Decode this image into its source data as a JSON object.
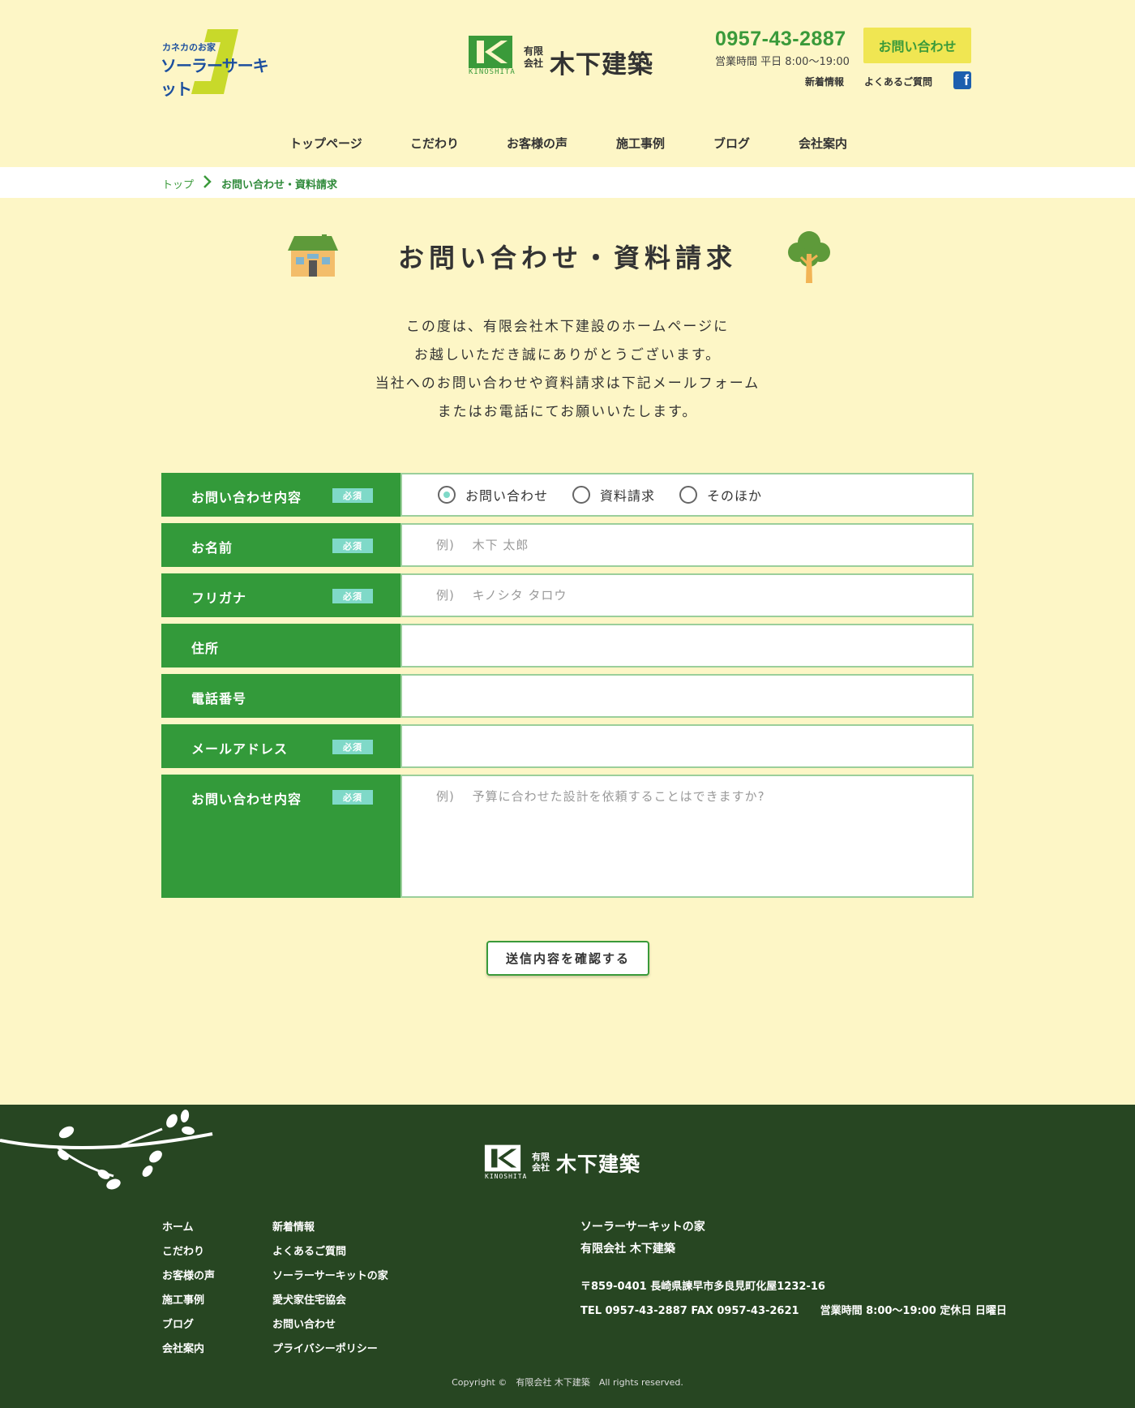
{
  "header": {
    "solar_logo_small": "カネカのお家",
    "solar_logo_main": "ソーラーサーキット",
    "brand_small_1": "有限",
    "brand_small_2": "会社",
    "brand_main": "木下建築",
    "brand_kino": "KINOSHITA",
    "phone": "0957-43-2887",
    "hours": "営業時間 平日 8:00〜19:00",
    "contact_button": "お問い合わせ",
    "util_news": "新着情報",
    "util_faq": "よくあるご質問",
    "facebook_glyph": "f"
  },
  "nav": [
    "トップページ",
    "こだわり",
    "お客様の声",
    "施工事例",
    "ブログ",
    "会社案内"
  ],
  "breadcrumb": {
    "top": "トップ",
    "current": "お問い合わせ・資料請求"
  },
  "main": {
    "title": "お問い合わせ・資料請求",
    "intro": [
      "この度は、有限会社木下建設のホームページに",
      "お越しいただき誠にありがとうございます。",
      "当社へのお問い合わせや資料請求は下記メールフォーム",
      "またはお電話にてお願いいたします。"
    ]
  },
  "form": {
    "required_badge": "必須",
    "type_label": "お問い合わせ内容",
    "type_options": [
      "お問い合わせ",
      "資料請求",
      "そのほか"
    ],
    "type_selected": "お問い合わせ",
    "name_label": "お名前",
    "name_placeholder": "例)　 木下 太郎",
    "kana_label": "フリガナ",
    "kana_placeholder": "例)　 キノシタ タロウ",
    "address_label": "住所",
    "address_value": "",
    "phone_label": "電話番号",
    "phone_value": "",
    "email_label": "メールアドレス",
    "email_value": "",
    "message_label": "お問い合わせ内容",
    "message_placeholder": "例)　 予算に合わせた設計を依頼することはできますか?",
    "submit_label": "送信内容を確認する"
  },
  "footer": {
    "brand_small_1": "有限",
    "brand_small_2": "会社",
    "brand_main": "木下建築",
    "brand_kino": "KINOSHITA",
    "links_col1": [
      "ホーム",
      "こだわり",
      "お客様の声",
      "施工事例",
      "ブログ",
      "会社案内"
    ],
    "links_col2": [
      "新着情報",
      "よくあるご質問",
      "ソーラーサーキットの家",
      "愛犬家住宅協会",
      "お問い合わせ",
      "プライバシーポリシー"
    ],
    "company_line1": "ソーラーサーキットの家",
    "company_line2": "有限会社 木下建築",
    "address": "〒859-0401 長崎県諫早市多良見町化屋1232-16",
    "tel_line": "TEL 0957-43-2887 FAX 0957-43-2621　　営業時間 8:00〜19:00 定休日 日曜日",
    "copyright": "Copyright ©　有限会社 木下建築　All rights reserved."
  },
  "colors": {
    "background": "#fdf6c6",
    "accent_green": "#339a3a",
    "footer_green": "#274622",
    "badge": "#7fd9c8",
    "button_yellow": "#f0e652"
  }
}
